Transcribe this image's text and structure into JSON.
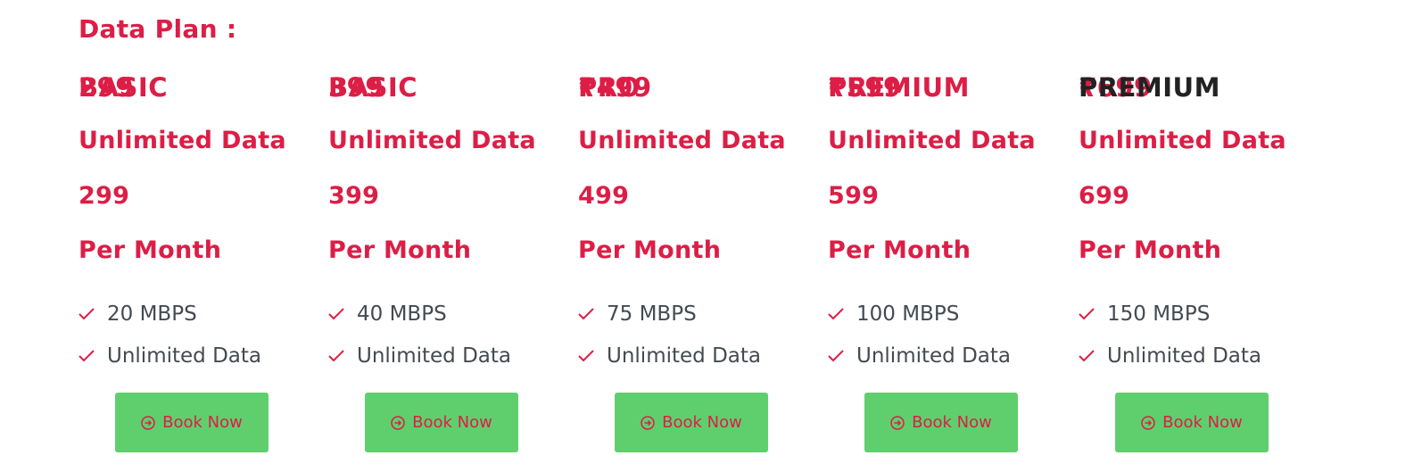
{
  "section": {
    "heading": "Data Plan :"
  },
  "plans": [
    {
      "price_label": "299",
      "name": "BASIC",
      "feature_title": "Unlimited Data",
      "price": "299",
      "period": "Per Month",
      "features": [
        "20 MBPS",
        "Unlimited Data"
      ],
      "button_label": "Book Now"
    },
    {
      "price_label": "399",
      "name": "BASIC",
      "feature_title": "Unlimited Data",
      "price": "399",
      "period": "Per Month",
      "features": [
        "40 MBPS",
        "Unlimited Data"
      ],
      "button_label": "Book Now"
    },
    {
      "price_label": "₹499",
      "name": "PRO",
      "feature_title": "Unlimited Data",
      "price": "499",
      "period": "Per Month",
      "features": [
        "75 MBPS",
        "Unlimited Data"
      ],
      "button_label": "Book Now"
    },
    {
      "price_label": "₹599",
      "name": "PREMIUM",
      "feature_title": "Unlimited Data",
      "price": "599",
      "period": "Per Month",
      "features": [
        "100 MBPS",
        "Unlimited Data"
      ],
      "button_label": "Book Now"
    },
    {
      "price_label": "₹699",
      "name": "PREMIUM",
      "feature_title": "Unlimited Data",
      "price": "699",
      "period": "Per Month",
      "features": [
        "150 MBPS",
        "Unlimited Data"
      ],
      "button_label": "Book Now"
    }
  ],
  "colors": {
    "accent": "#dc1e46",
    "button": "#5fcf6e",
    "feature_text": "#444a51",
    "dark_title": "#222222"
  },
  "icons": {
    "feature": "check-icon",
    "button": "circle-arrow-right-icon"
  }
}
